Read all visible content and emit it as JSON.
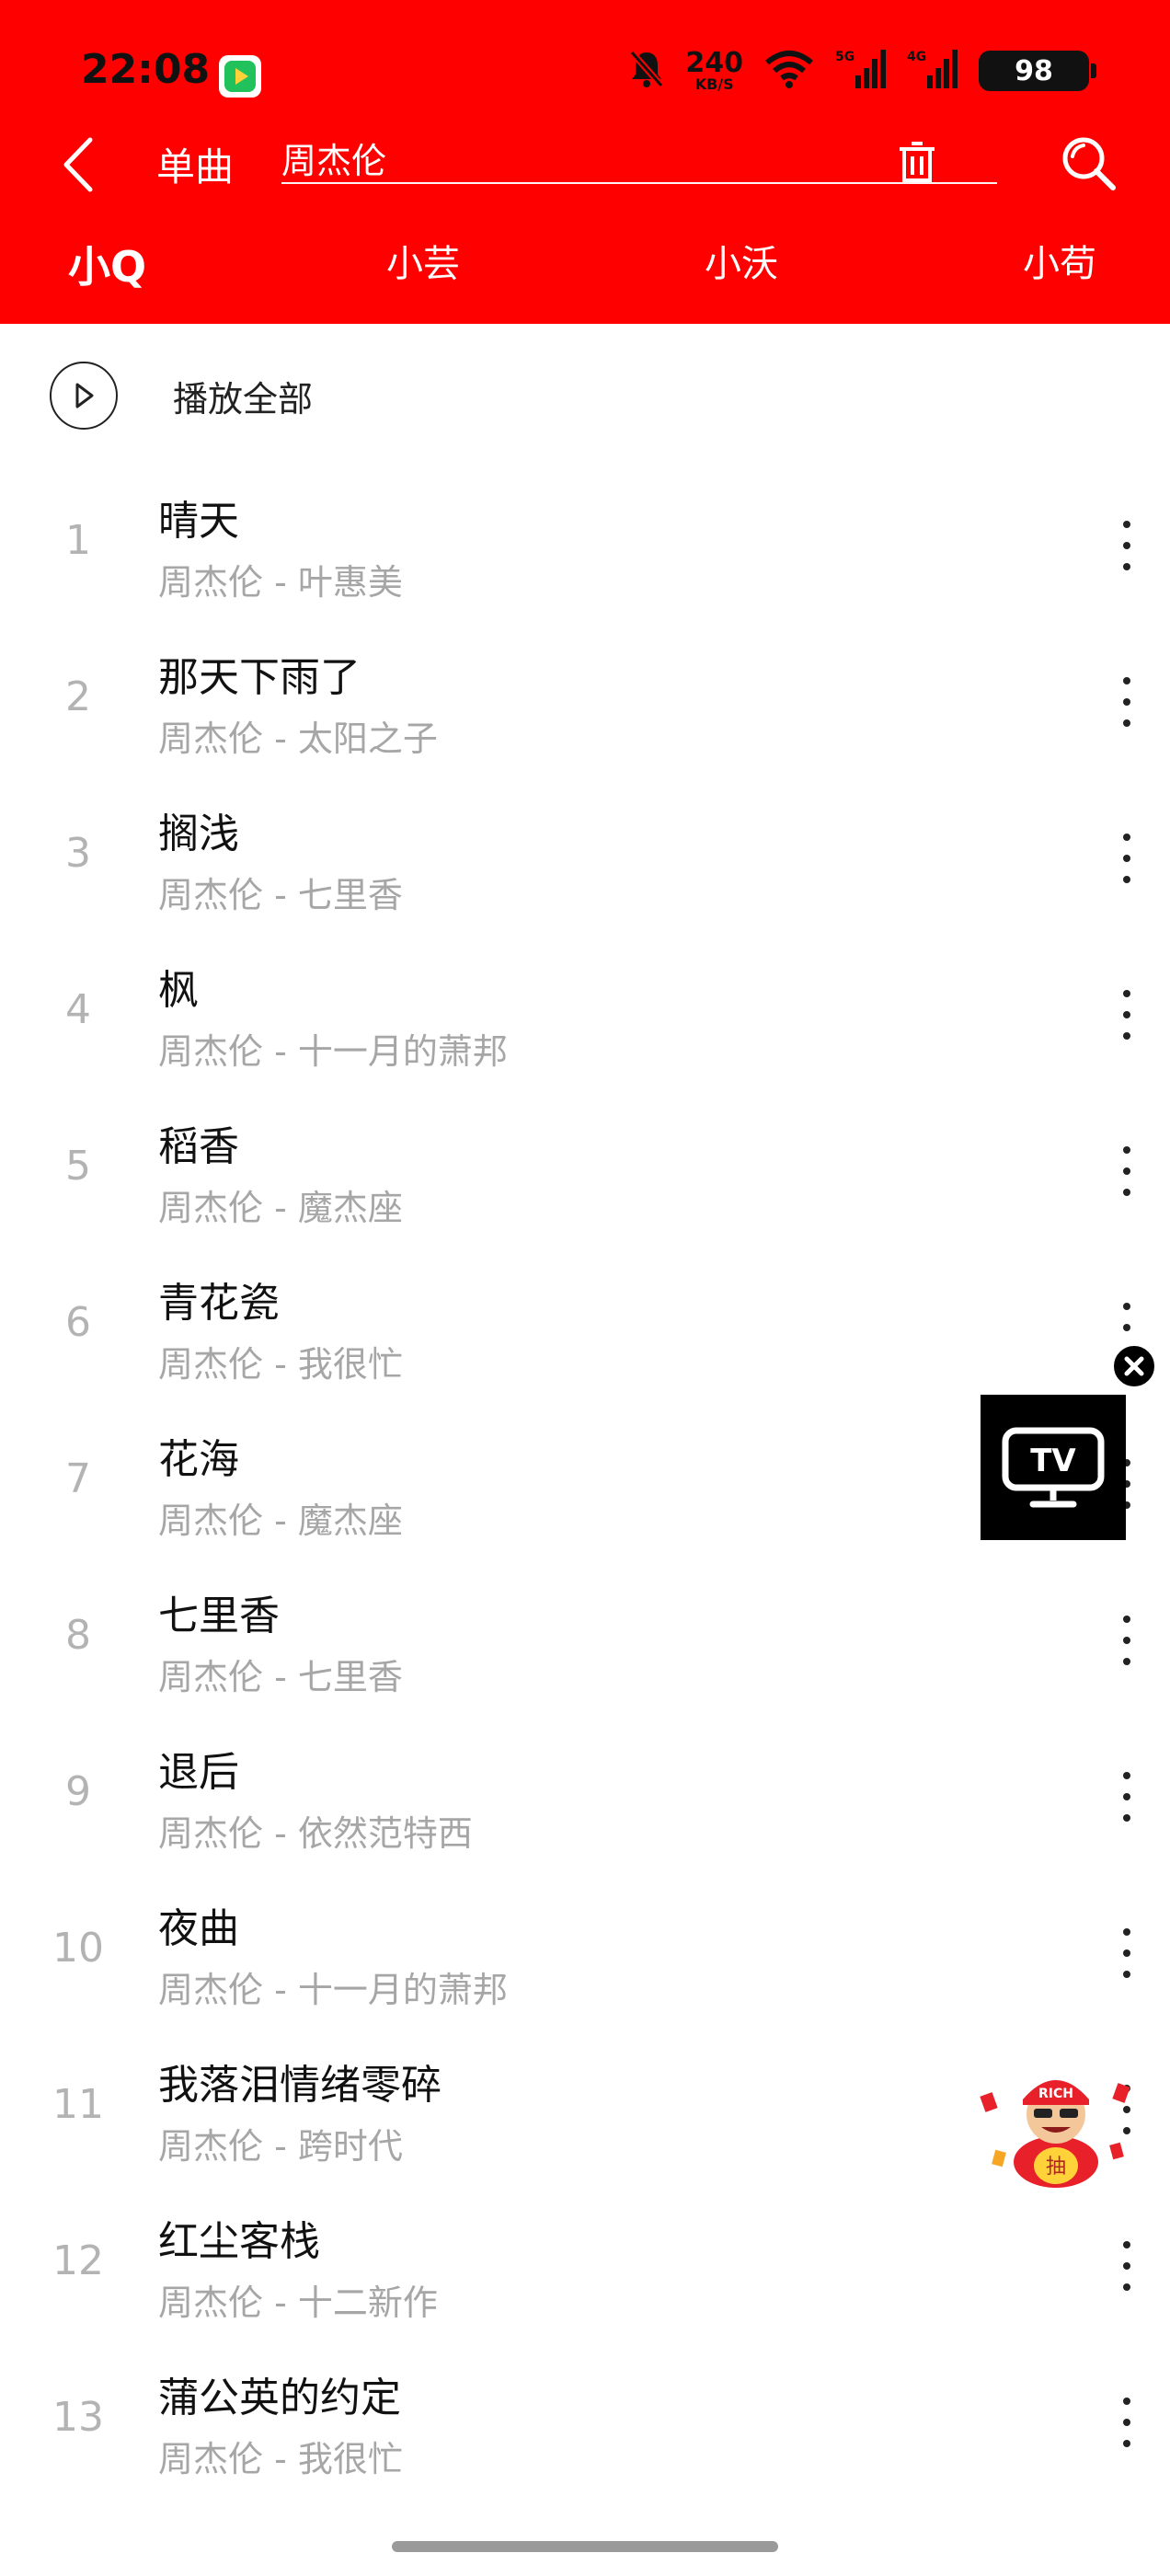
{
  "status_bar": {
    "time": "22:08",
    "speed_value": "240",
    "speed_unit": "KB/S",
    "battery": "98",
    "app_badge_text": "□"
  },
  "header": {
    "type_label": "单曲",
    "search_value": "周杰伦",
    "icons": {
      "back": "back-arrow-icon",
      "clear": "trash-icon",
      "search": "search-icon"
    }
  },
  "tabs": [
    {
      "label": "小Q",
      "active": true
    },
    {
      "label": "小芸",
      "active": false
    },
    {
      "label": "小沃",
      "active": false
    },
    {
      "label": "小苟",
      "active": false
    }
  ],
  "play_all": {
    "label": "播放全部"
  },
  "songs": [
    {
      "index": "1",
      "title": "晴天",
      "subtitle": "周杰伦 - 叶惠美"
    },
    {
      "index": "2",
      "title": "那天下雨了",
      "subtitle": "周杰伦 - 太阳之子"
    },
    {
      "index": "3",
      "title": "搁浅",
      "subtitle": "周杰伦 - 七里香"
    },
    {
      "index": "4",
      "title": "枫",
      "subtitle": "周杰伦 - 十一月的萧邦"
    },
    {
      "index": "5",
      "title": "稻香",
      "subtitle": "周杰伦 - 魔杰座"
    },
    {
      "index": "6",
      "title": "青花瓷",
      "subtitle": "周杰伦 - 我很忙"
    },
    {
      "index": "7",
      "title": "花海",
      "subtitle": "周杰伦 - 魔杰座"
    },
    {
      "index": "8",
      "title": "七里香",
      "subtitle": "周杰伦 - 七里香"
    },
    {
      "index": "9",
      "title": "退后",
      "subtitle": "周杰伦 - 依然范特西"
    },
    {
      "index": "10",
      "title": "夜曲",
      "subtitle": "周杰伦 - 十一月的萧邦"
    },
    {
      "index": "11",
      "title": "我落泪情绪零碎",
      "subtitle": "周杰伦 - 跨时代"
    },
    {
      "index": "12",
      "title": "红尘客栈",
      "subtitle": "周杰伦 - 十二新作"
    },
    {
      "index": "13",
      "title": "蒲公英的约定",
      "subtitle": "周杰伦 - 我很忙"
    }
  ],
  "floating": {
    "tv_label": "TV",
    "mascot_hat_text": "RICH",
    "mascot_belly_text": "抽"
  },
  "colors": {
    "brand": "#ff0000",
    "subtext": "#a6a6a6",
    "index": "#b3b3b3"
  }
}
